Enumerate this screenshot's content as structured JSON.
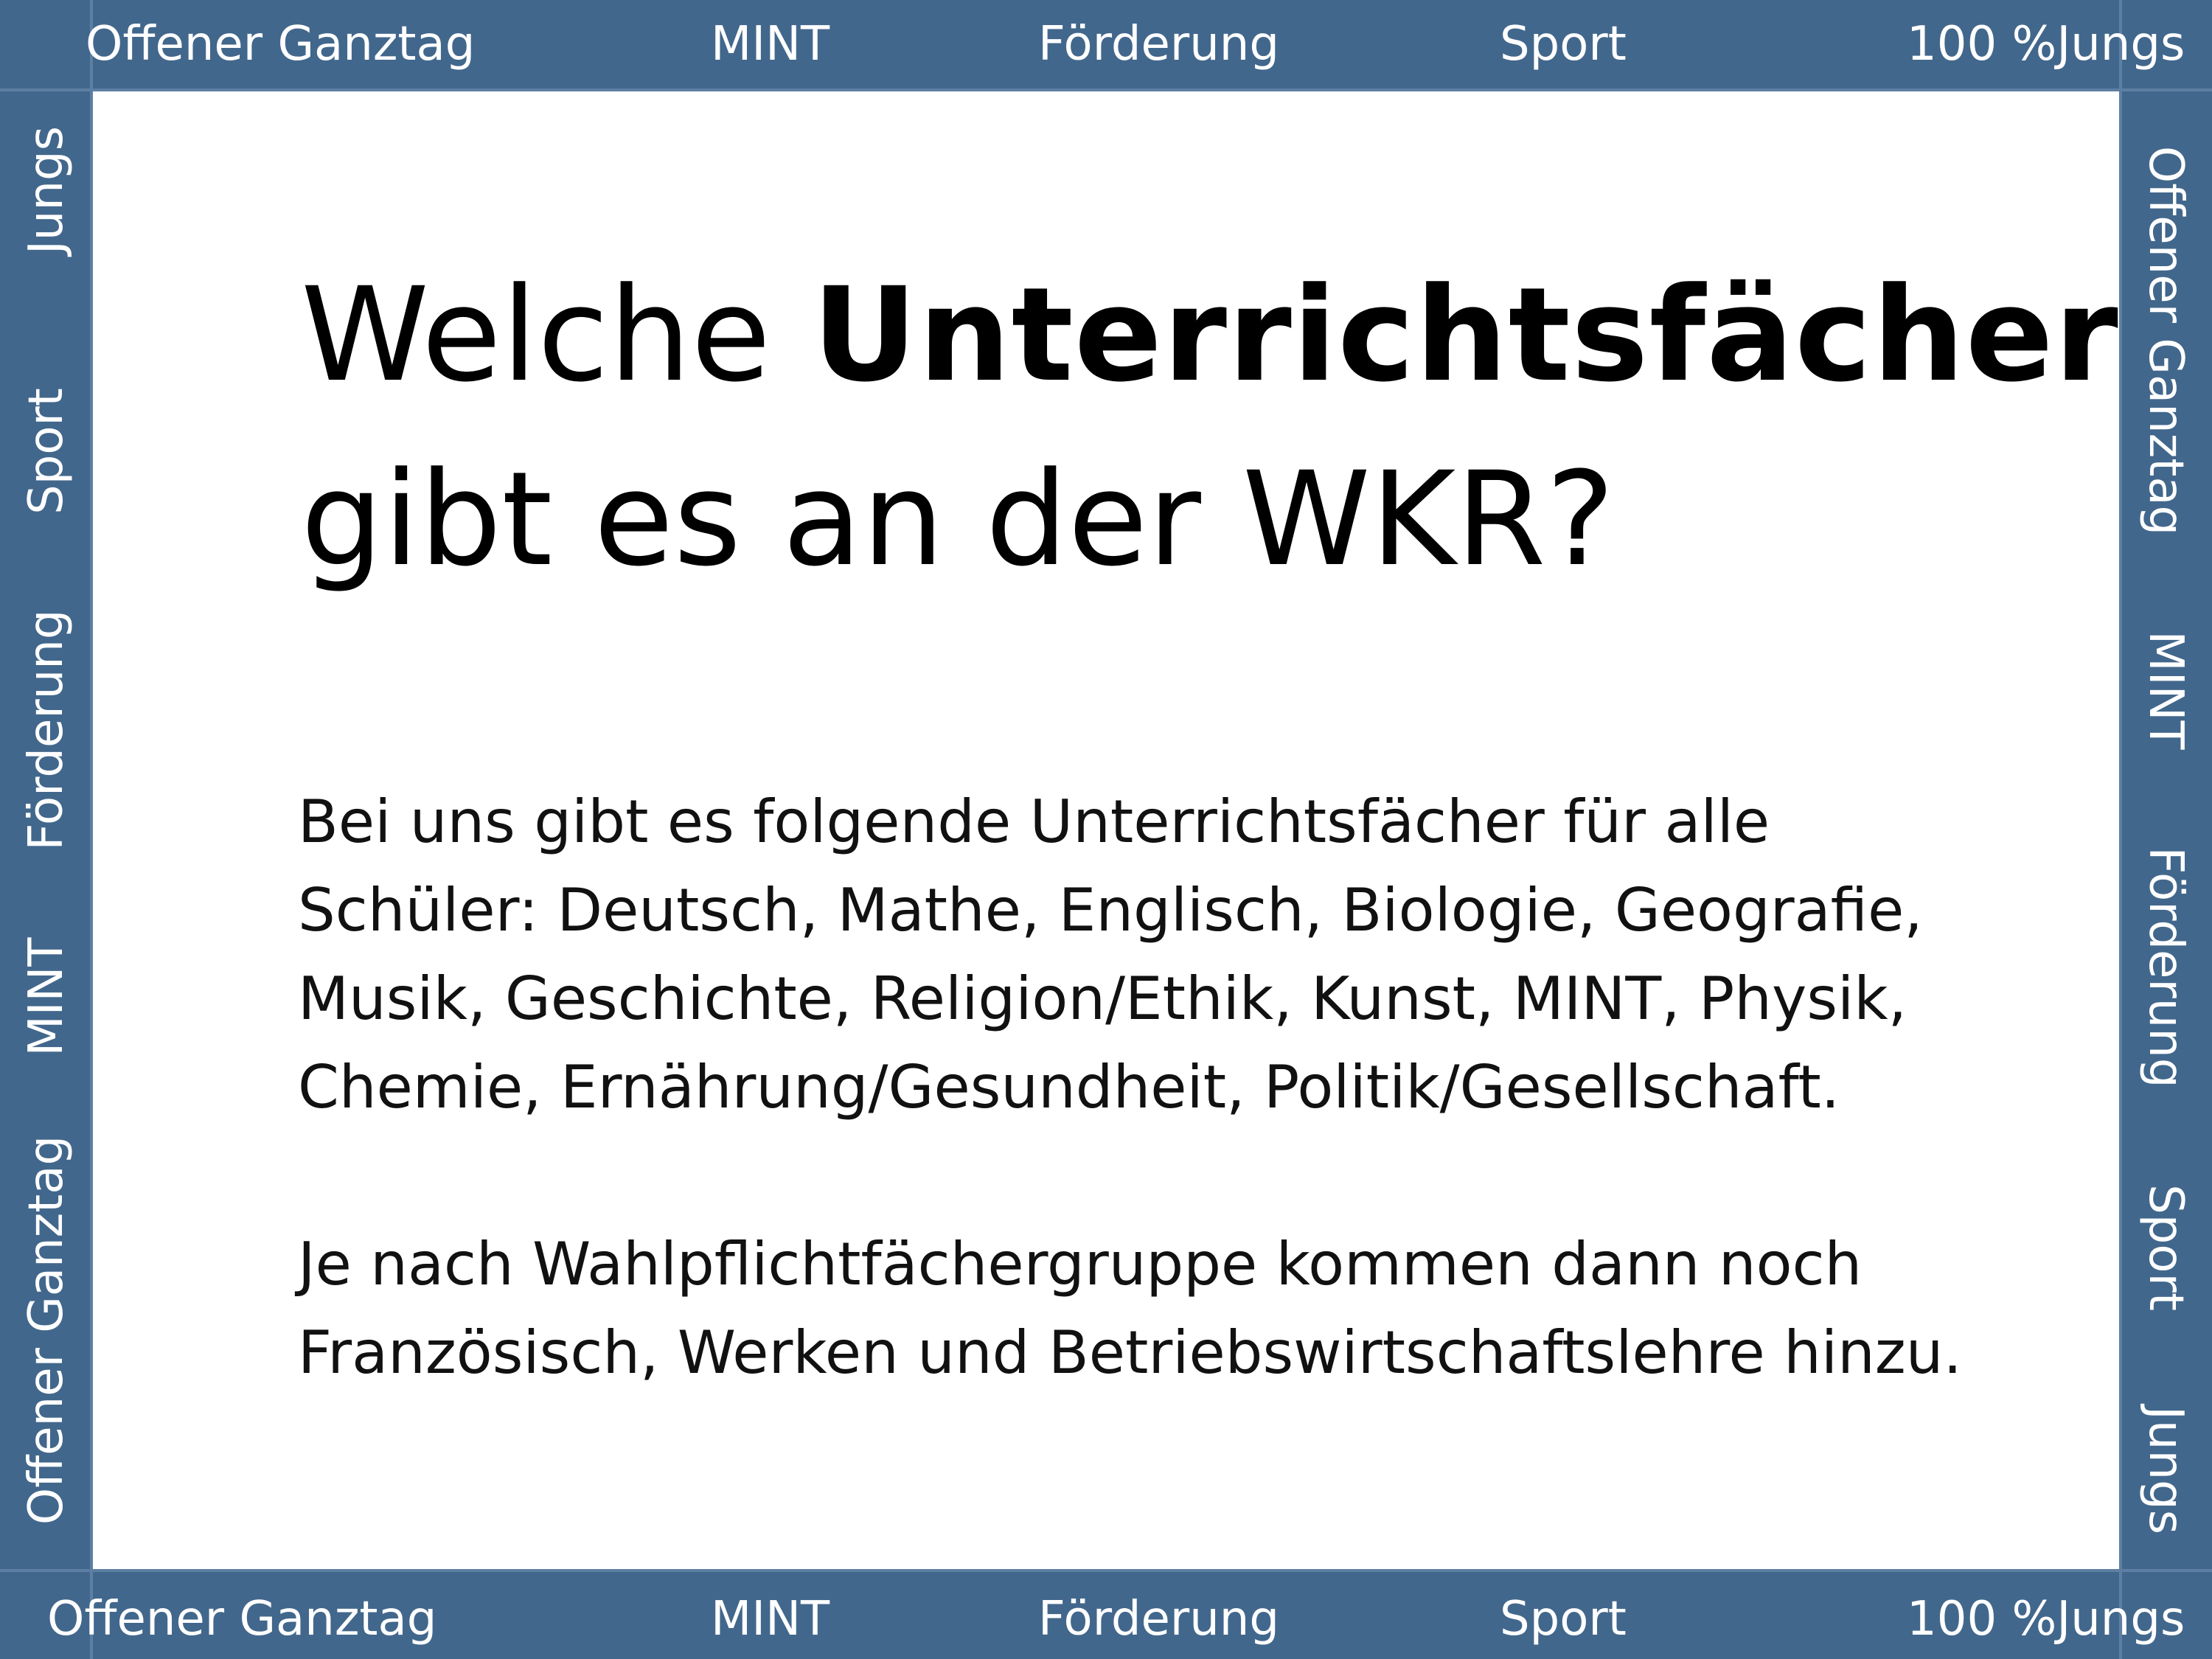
{
  "top_band": [
    "Offener Ganztag",
    "MINT",
    "Förderung",
    "Sport",
    "100 %Jungs"
  ],
  "bottom_band": [
    "Offener Ganztag",
    "MINT",
    "Förderung",
    "Sport",
    "100 %Jungs"
  ],
  "left_band": [
    "Jungs",
    "Sport",
    "Förderung",
    "MINT",
    "Offener Ganztag"
  ],
  "right_band": [
    "Offener Ganztag",
    "MINT",
    "Förderung",
    "Sport",
    "Jungs"
  ],
  "title": {
    "line1_plain": "Welche ",
    "line1_bold": "Unterrichtsfächer",
    "line2": "gibt es an der WKR?"
  },
  "body": {
    "para1": [
      "Bei uns gibt es folgende Unterrichtsfächer für alle",
      "Schüler: Deutsch, Mathe, Englisch, Biologie, Geografie,",
      "Musik, Geschichte, Religion/Ethik, Kunst, MINT, Physik,",
      "Chemie, Ernährung/Gesundheit, Politik/Gesellschaft."
    ],
    "para2": [
      "Je nach Wahlpflichtfächergruppe kommen dann noch",
      "Französisch, Werken und Betriebswirtschaftslehre hinzu."
    ]
  }
}
